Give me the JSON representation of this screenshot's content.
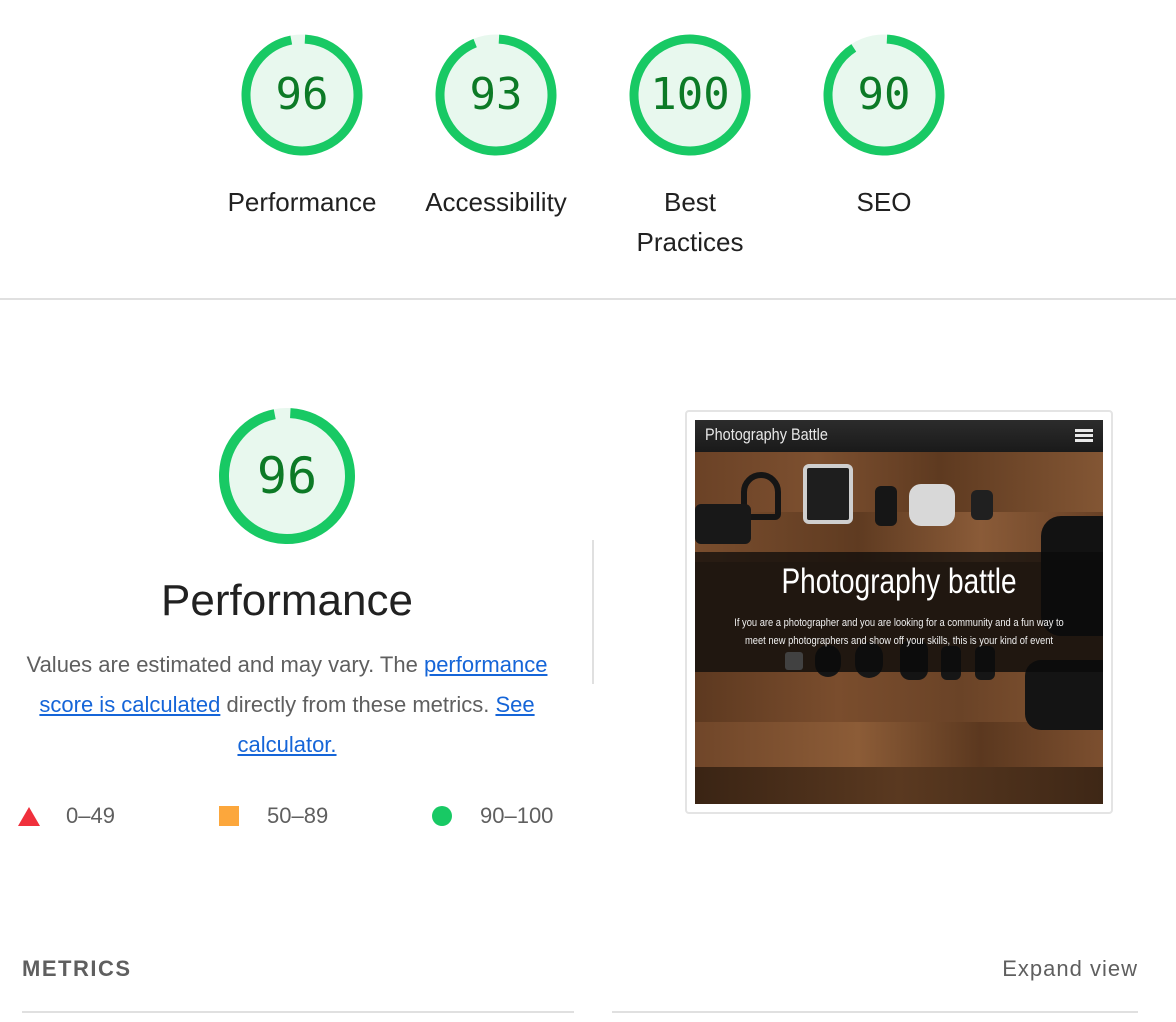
{
  "scores": [
    {
      "name": "performance",
      "value": "96",
      "score": 96,
      "label": "Performance"
    },
    {
      "name": "accessibility",
      "value": "93",
      "score": 93,
      "label": "Accessibility"
    },
    {
      "name": "best-practices",
      "value": "100",
      "score": 100,
      "label": "Best Practices"
    },
    {
      "name": "seo",
      "value": "90",
      "score": 90,
      "label": "SEO"
    }
  ],
  "performance": {
    "score_text": "96",
    "score": 96,
    "title": "Performance",
    "desc_part1": "Values are estimated and may vary. The ",
    "desc_link1": "performance score is calculated",
    "desc_part2": " directly from these metrics. ",
    "desc_link2": "See calculator."
  },
  "legend": {
    "fail": "0–49",
    "average": "50–89",
    "pass": "90–100"
  },
  "thumbnail": {
    "nav_title": "Photography Battle",
    "heading": "Photography battle",
    "subtext": "If you are a photographer and you are looking for a community and a fun way to meet new photographers and show off your skills, this is your kind of event"
  },
  "metrics": {
    "label": "METRICS",
    "expand": "Expand view"
  },
  "colors": {
    "pass": "#18c964",
    "pass_text": "#0c7a26",
    "pass_bg": "#e8f8ee",
    "average": "#fca73c",
    "fail": "#f0303c",
    "link": "#1565d8"
  }
}
